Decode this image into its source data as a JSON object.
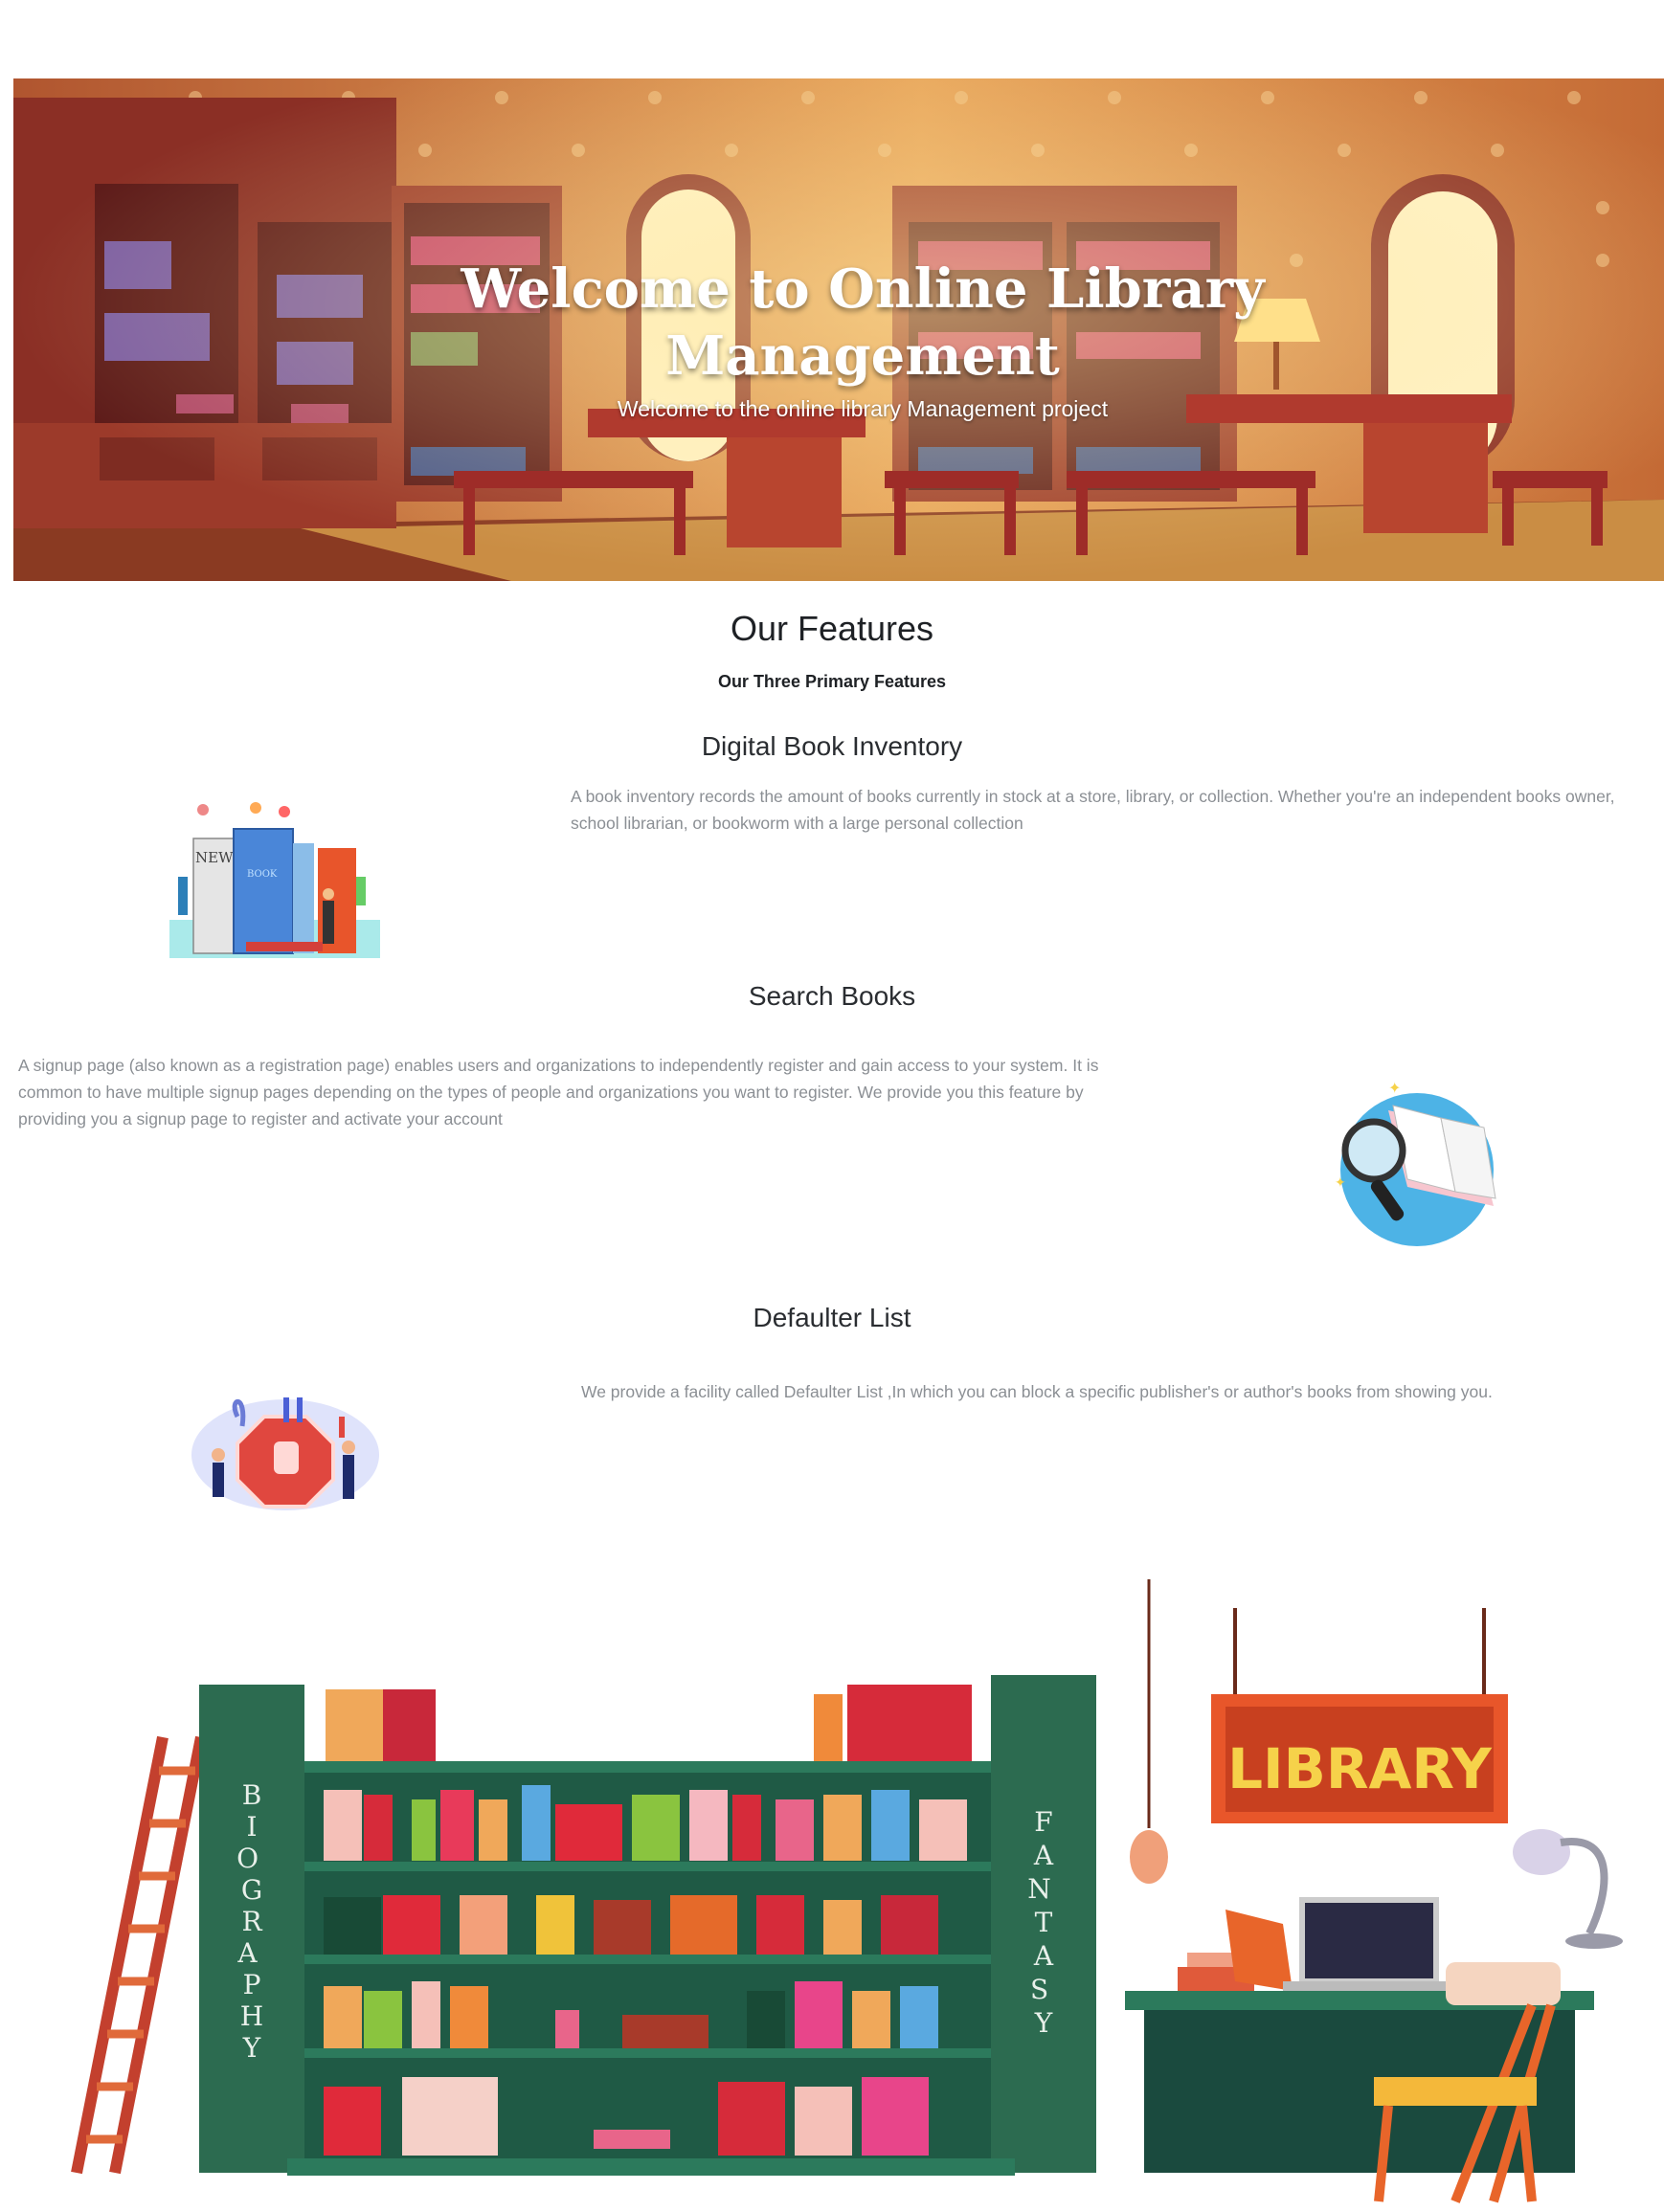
{
  "hero": {
    "title": "Welcome to Online Library Management",
    "subtitle": "Welcome to the online library Management project"
  },
  "features": {
    "heading": "Our Features",
    "subheading": "Our Three Primary Features",
    "items": [
      {
        "title": "Digital Book Inventory",
        "description": "A book inventory records the amount of books currently in stock at a store, library, or collection. Whether you're an independent books owner, school librarian, or bookworm with a large personal collection",
        "image_label_1": "NEW",
        "image_label_2": "BOOK"
      },
      {
        "title": "Search Books",
        "description": "A signup page (also known as a registration page) enables users and organizations to independently register and gain access to your system. It is common to have multiple signup pages depending on the types of people and organizations you want to register. We provide you this feature by providing you a signup page to register and activate your account"
      },
      {
        "title": "Defaulter List",
        "description": "We provide a facility called Defaulter List ,In which you can block a specific publisher's or author's books from showing you."
      }
    ]
  },
  "footer_illustration": {
    "left_shelf_label": "BIOGRAPHY",
    "right_shelf_label": "FANTASY",
    "sign_label": "LIBRARY"
  }
}
